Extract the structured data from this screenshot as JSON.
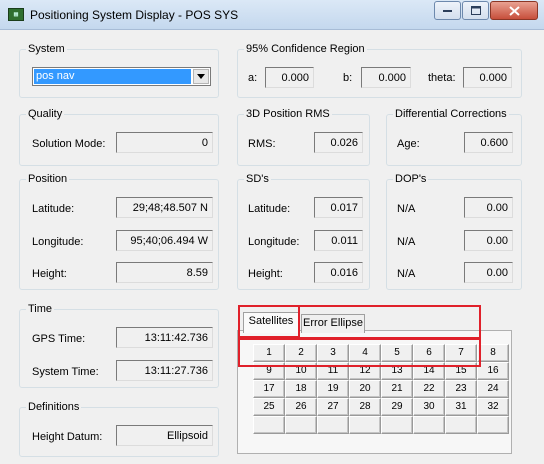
{
  "window": {
    "title": "Positioning System Display - POS SYS",
    "icon": "app-icon",
    "controls": [
      "minimize-icon",
      "maximize-icon",
      "close-icon"
    ]
  },
  "system": {
    "group_label": "System",
    "selected": "pos nav"
  },
  "confidence": {
    "group_label": "95% Confidence Region",
    "a_label": "a:",
    "a_value": "0.000",
    "b_label": "b:",
    "b_value": "0.000",
    "theta_label": "theta:",
    "theta_value": "0.000"
  },
  "quality": {
    "group_label": "Quality",
    "mode_label": "Solution Mode:",
    "mode_value": "0"
  },
  "rms": {
    "group_label": "3D Position RMS",
    "label": "RMS:",
    "value": "0.026"
  },
  "diff": {
    "group_label": "Differential Corrections",
    "age_label": "Age:",
    "age_value": "0.600"
  },
  "position": {
    "group_label": "Position",
    "lat_label": "Latitude:",
    "lat_value": "29;48;48.507 N",
    "lon_label": "Longitude:",
    "lon_value": "95;40;06.494 W",
    "height_label": "Height:",
    "height_value": "8.59"
  },
  "sds": {
    "group_label": "SD's",
    "lat_label": "Latitude:",
    "lat_value": "0.017",
    "lon_label": "Longitude:",
    "lon_value": "0.011",
    "height_label": "Height:",
    "height_value": "0.016"
  },
  "dops": {
    "group_label": "DOP's",
    "row1_label": "N/A",
    "row1_value": "0.00",
    "row2_label": "N/A",
    "row2_value": "0.00",
    "row3_label": "N/A",
    "row3_value": "0.00"
  },
  "time": {
    "group_label": "Time",
    "gps_label": "GPS Time:",
    "gps_value": "13:11:42.736",
    "system_label": "System Time:",
    "system_value": "13:11:27.736"
  },
  "definitions": {
    "group_label": "Definitions",
    "datum_label": "Height Datum:",
    "datum_value": "Ellipsoid"
  },
  "tabs": {
    "satellites": "Satellites",
    "error_ellipse": "Error Ellipse"
  },
  "satellites": {
    "rows": [
      [
        "1",
        "2",
        "3",
        "4",
        "5",
        "6",
        "7",
        "8"
      ],
      [
        "9",
        "10",
        "11",
        "12",
        "13",
        "14",
        "15",
        "16"
      ],
      [
        "17",
        "18",
        "19",
        "20",
        "21",
        "22",
        "23",
        "24"
      ],
      [
        "25",
        "26",
        "27",
        "28",
        "29",
        "30",
        "31",
        "32"
      ],
      [
        "",
        "",
        "",
        "",
        "",
        "",
        "",
        ""
      ]
    ]
  },
  "colors": {
    "highlight_box": "#e0202a",
    "selection": "#3399ff"
  }
}
